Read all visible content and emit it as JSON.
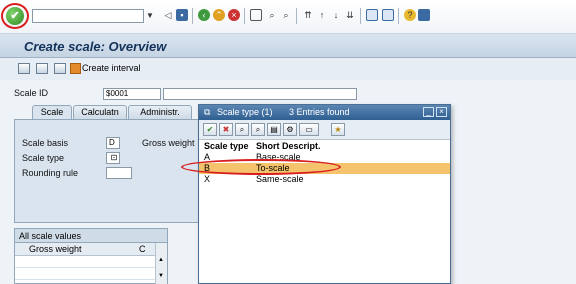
{
  "toolbar": {
    "enter_icon": "check-icon",
    "command_value": "",
    "icons": [
      "back-icon",
      "exit-icon",
      "cancel-icon",
      "print-icon",
      "find-icon",
      "find-next-icon",
      "first-page-icon",
      "prev-page-icon",
      "next-page-icon",
      "last-page-icon",
      "new-session-icon",
      "shortcut-icon",
      "help-icon",
      "customize-icon"
    ]
  },
  "title": "Create scale: Overview",
  "app_toolbar": {
    "create_interval": "Create interval"
  },
  "scale_id": {
    "label": "Scale ID",
    "value": "$0001"
  },
  "tabs": [
    {
      "label": "Scale"
    },
    {
      "label": "Calculatn"
    },
    {
      "label": "Administr."
    }
  ],
  "scale_tab": {
    "scale_basis_label": "Scale basis",
    "scale_basis_value": "D",
    "scale_type_label": "Scale type",
    "scale_type_value": "",
    "rounding_label": "Rounding rule",
    "rounding_value": "",
    "gross_weight_label": "Gross weight"
  },
  "values_table": {
    "title": "All scale values",
    "col1": "Gross weight",
    "col2": "C"
  },
  "popup": {
    "title": "Scale type (1)",
    "entries_found": "3 Entries found",
    "columns": [
      "Scale type",
      "Short Descript."
    ],
    "rows": [
      {
        "code": "A",
        "desc": "Base-scale"
      },
      {
        "code": "B",
        "desc": "To-scale"
      },
      {
        "code": "X",
        "desc": "Same-scale"
      }
    ],
    "selected_index": 1
  },
  "colors": {
    "highlight": "#d81f1f",
    "selection": "#f4c36b",
    "popup_title_bg": "#2f5f91"
  }
}
